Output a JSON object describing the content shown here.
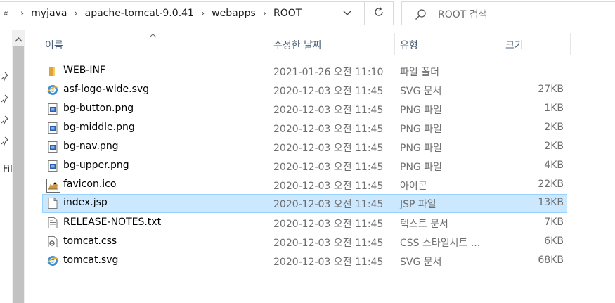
{
  "address_bar": {
    "overflow_glyph": "«",
    "separator": "›",
    "crumbs": [
      "myjava",
      "apache-tomcat-9.0.41",
      "webapps",
      "ROOT"
    ]
  },
  "search": {
    "placeholder": "ROOT 검색"
  },
  "nav_pane": {
    "label": "Fil"
  },
  "columns": {
    "name": "이름",
    "date": "수정한 날짜",
    "type": "유형",
    "size": "크기"
  },
  "files": [
    {
      "name": "WEB-INF",
      "date": "2021-01-26 오전 11:10",
      "type": "파일 폴더",
      "size": "",
      "icon": "folder-icon"
    },
    {
      "name": "asf-logo-wide.svg",
      "date": "2020-12-03 오전 11:45",
      "type": "SVG 문서",
      "size": "27KB",
      "icon": "svg-file-icon"
    },
    {
      "name": "bg-button.png",
      "date": "2020-12-03 오전 11:45",
      "type": "PNG 파일",
      "size": "1KB",
      "icon": "png-file-icon"
    },
    {
      "name": "bg-middle.png",
      "date": "2020-12-03 오전 11:45",
      "type": "PNG 파일",
      "size": "2KB",
      "icon": "png-file-icon"
    },
    {
      "name": "bg-nav.png",
      "date": "2020-12-03 오전 11:45",
      "type": "PNG 파일",
      "size": "2KB",
      "icon": "png-file-icon"
    },
    {
      "name": "bg-upper.png",
      "date": "2020-12-03 오전 11:45",
      "type": "PNG 파일",
      "size": "4KB",
      "icon": "png-file-icon"
    },
    {
      "name": "favicon.ico",
      "date": "2020-12-03 오전 11:45",
      "type": "아이콘",
      "size": "22KB",
      "icon": "favicon-icon"
    },
    {
      "name": "index.jsp",
      "date": "2020-12-03 오전 11:45",
      "type": "JSP 파일",
      "size": "13KB",
      "icon": "jsp-file-icon",
      "selected": true
    },
    {
      "name": "RELEASE-NOTES.txt",
      "date": "2020-12-03 오전 11:45",
      "type": "텍스트 문서",
      "size": "7KB",
      "icon": "text-file-icon"
    },
    {
      "name": "tomcat.css",
      "date": "2020-12-03 오전 11:45",
      "type": "CSS 스타일시트 ...",
      "size": "6KB",
      "icon": "css-file-icon"
    },
    {
      "name": "tomcat.svg",
      "date": "2020-12-03 오전 11:45",
      "type": "SVG 문서",
      "size": "68KB",
      "icon": "svg-file-icon"
    }
  ],
  "colors": {
    "selected_bg": "#cce8ff",
    "selected_border": "#99d1ff",
    "header_text": "#4c607a",
    "folder": "#e8b84a"
  }
}
